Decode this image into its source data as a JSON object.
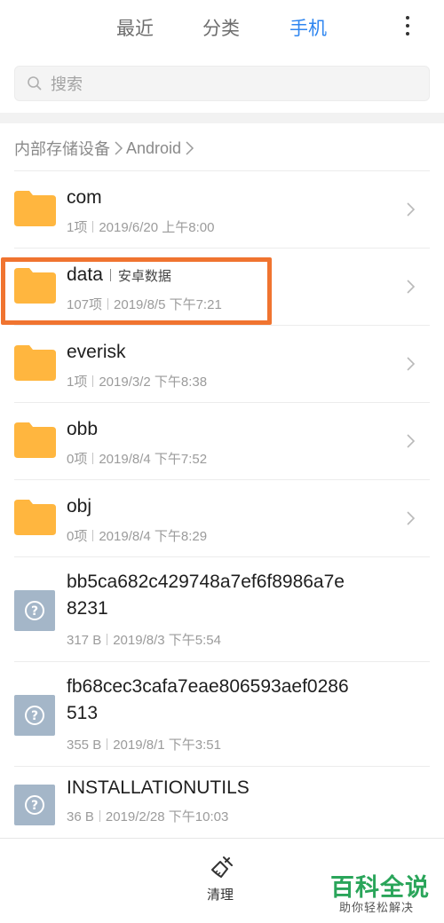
{
  "tabs": [
    {
      "label": "最近"
    },
    {
      "label": "分类"
    },
    {
      "label": "手机"
    }
  ],
  "active_tab": "手机",
  "accent_color": "#2f86f0",
  "highlight_color": "#f07430",
  "search": {
    "placeholder": "搜索"
  },
  "breadcrumb": {
    "root": "内部存储设备",
    "current": "Android"
  },
  "items": [
    {
      "name": "com",
      "type": "folder",
      "count": "1项",
      "date": "2019/6/20 上午8:00"
    },
    {
      "name": "data",
      "type": "folder",
      "tag": "安卓数据",
      "count": "107项",
      "date": "2019/8/5 下午7:21",
      "highlighted": true
    },
    {
      "name": "everisk",
      "type": "folder",
      "count": "1项",
      "date": "2019/3/2 下午8:38"
    },
    {
      "name": "obb",
      "type": "folder",
      "count": "0项",
      "date": "2019/8/4 下午7:52"
    },
    {
      "name": "obj",
      "type": "folder",
      "count": "0项",
      "date": "2019/8/4 下午8:29"
    },
    {
      "name_line1": "bb5ca682c429748a7ef6f8986a7e",
      "name_line2": "8231",
      "type": "file",
      "size": "317 B",
      "date": "2019/8/3 下午5:54"
    },
    {
      "name_line1": "fb68cec3cafa7eae806593aef0286",
      "name_line2": "513",
      "type": "file",
      "size": "355 B",
      "date": "2019/8/1 下午3:51"
    },
    {
      "name": "INSTALLATIONUTILS",
      "type": "file",
      "size": "36 B",
      "date": "2019/2/28 下午10:03"
    }
  ],
  "bottom": {
    "clean_label": "清理"
  },
  "watermark": {
    "title": "百科全说",
    "subtitle": "助你轻松解决"
  }
}
